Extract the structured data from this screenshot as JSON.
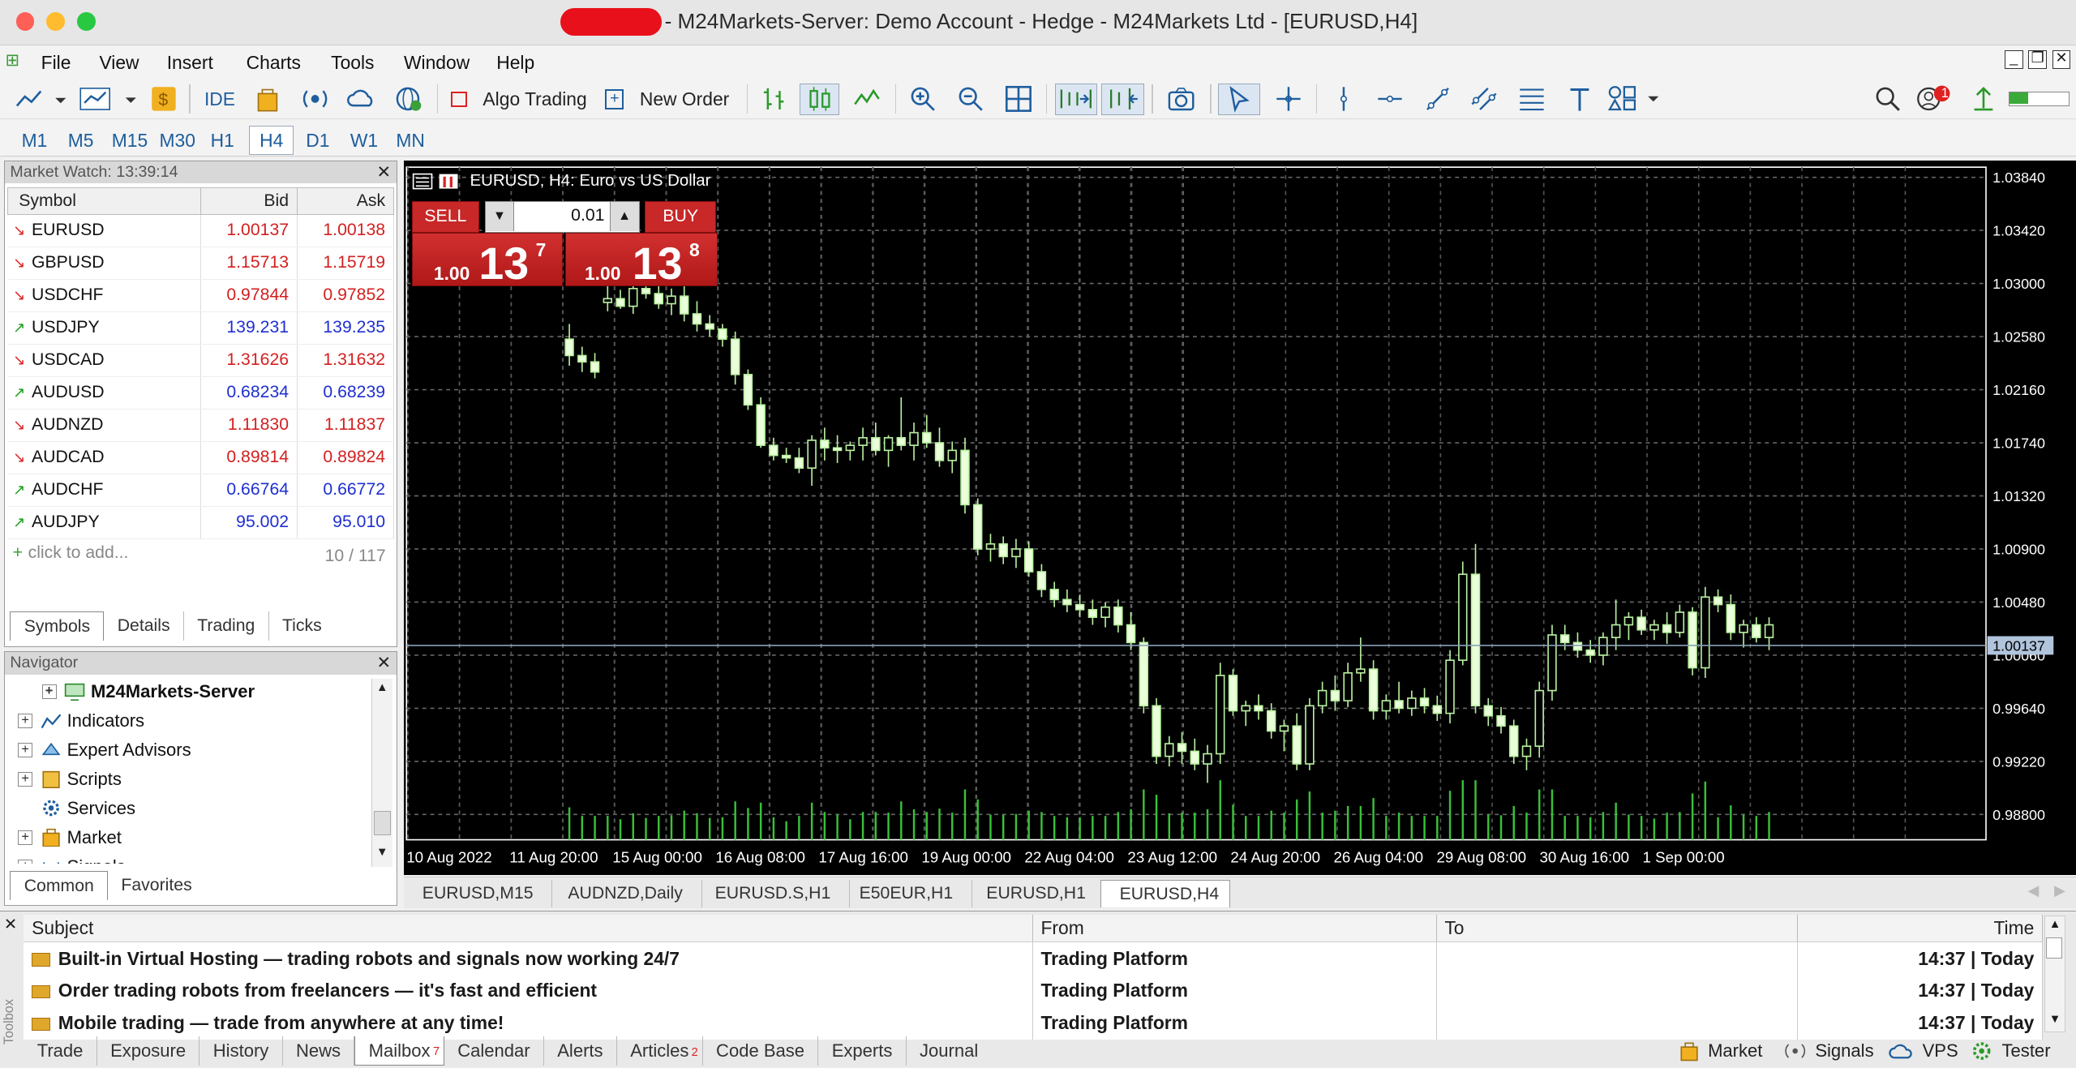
{
  "window": {
    "title": "- M24Markets-Server: Demo Account - Hedge - M24Markets Ltd - [EURUSD,H4]"
  },
  "menu": [
    "File",
    "View",
    "Insert",
    "Charts",
    "Tools",
    "Window",
    "Help"
  ],
  "toolbar": {
    "ide": "IDE",
    "algo_trading": "Algo Trading",
    "new_order": "New Order",
    "notification_count": "1"
  },
  "timeframes": [
    "M1",
    "M5",
    "M15",
    "M30",
    "H1",
    "H4",
    "D1",
    "W1",
    "MN"
  ],
  "active_timeframe": "H4",
  "market_watch": {
    "title": "Market Watch: 13:39:14",
    "columns": [
      "Symbol",
      "Bid",
      "Ask"
    ],
    "rows": [
      {
        "symbol": "EURUSD",
        "bid": "1.00137",
        "ask": "1.00138",
        "dir": "down",
        "color": "red"
      },
      {
        "symbol": "GBPUSD",
        "bid": "1.15713",
        "ask": "1.15719",
        "dir": "down",
        "color": "red"
      },
      {
        "symbol": "USDCHF",
        "bid": "0.97844",
        "ask": "0.97852",
        "dir": "down",
        "color": "red"
      },
      {
        "symbol": "USDJPY",
        "bid": "139.231",
        "ask": "139.235",
        "dir": "up",
        "color": "blue"
      },
      {
        "symbol": "USDCAD",
        "bid": "1.31626",
        "ask": "1.31632",
        "dir": "down",
        "color": "red"
      },
      {
        "symbol": "AUDUSD",
        "bid": "0.68234",
        "ask": "0.68239",
        "dir": "up",
        "color": "blue"
      },
      {
        "symbol": "AUDNZD",
        "bid": "1.11830",
        "ask": "1.11837",
        "dir": "down",
        "color": "red"
      },
      {
        "symbol": "AUDCAD",
        "bid": "0.89814",
        "ask": "0.89824",
        "dir": "down",
        "color": "red"
      },
      {
        "symbol": "AUDCHF",
        "bid": "0.66764",
        "ask": "0.66772",
        "dir": "up",
        "color": "blue"
      },
      {
        "symbol": "AUDJPY",
        "bid": "95.002",
        "ask": "95.010",
        "dir": "up",
        "color": "blue"
      }
    ],
    "add_label": "click to add...",
    "count": "10 / 117",
    "tabs": [
      "Symbols",
      "Details",
      "Trading",
      "Ticks"
    ]
  },
  "navigator": {
    "title": "Navigator",
    "items": [
      "M24Markets-Server",
      "Indicators",
      "Expert Advisors",
      "Scripts",
      "Services",
      "Market",
      "Signals"
    ],
    "tabs": [
      "Common",
      "Favorites"
    ]
  },
  "chart": {
    "header": "EURUSD, H4:  Euro vs US Dollar",
    "sell_label": "SELL",
    "buy_label": "BUY",
    "lot": "0.01",
    "sell_small": "1.00",
    "sell_big": "13",
    "sell_sup": "7",
    "buy_small": "1.00",
    "buy_big": "13",
    "buy_sup": "8",
    "current_price": "1.00137",
    "price_labels": [
      "1.03840",
      "1.03420",
      "1.03000",
      "1.02580",
      "1.02160",
      "1.01740",
      "1.01320",
      "1.00900",
      "1.00480",
      "1.00060",
      "0.99640",
      "0.99220",
      "0.98800"
    ],
    "time_labels": [
      "10 Aug 2022",
      "11 Aug 20:00",
      "15 Aug 00:00",
      "16 Aug 08:00",
      "17 Aug 16:00",
      "19 Aug 00:00",
      "22 Aug 04:00",
      "23 Aug 12:00",
      "24 Aug 20:00",
      "26 Aug 04:00",
      "29 Aug 08:00",
      "30 Aug 16:00",
      "1 Sep 00:00"
    ]
  },
  "chart_data": {
    "type": "candlestick",
    "symbol": "EURUSD",
    "timeframe": "H4",
    "ylim": [
      0.986,
      1.0392
    ],
    "candles": [
      [
        1.0256,
        1.0268,
        1.0235,
        1.0243
      ],
      [
        1.0243,
        1.025,
        1.023,
        1.0238
      ],
      [
        1.0238,
        1.0245,
        1.0225,
        1.023
      ],
      [
        1.0285,
        1.0298,
        1.0278,
        1.0288
      ],
      [
        1.0288,
        1.0295,
        1.028,
        1.0282
      ],
      [
        1.0282,
        1.03,
        1.0276,
        1.0296
      ],
      [
        1.0296,
        1.0305,
        1.0288,
        1.0292
      ],
      [
        1.0292,
        1.03,
        1.028,
        1.0284
      ],
      [
        1.0284,
        1.0296,
        1.0275,
        1.029
      ],
      [
        1.029,
        1.0298,
        1.027,
        1.0276
      ],
      [
        1.0276,
        1.0286,
        1.0262,
        1.0268
      ],
      [
        1.0268,
        1.0275,
        1.0258,
        1.0264
      ],
      [
        1.0264,
        1.0268,
        1.025,
        1.0256
      ],
      [
        1.0256,
        1.0262,
        1.022,
        1.0228
      ],
      [
        1.0228,
        1.0232,
        1.02,
        1.0204
      ],
      [
        1.0204,
        1.021,
        1.017,
        1.0172
      ],
      [
        1.0172,
        1.0178,
        1.016,
        1.0164
      ],
      [
        1.0164,
        1.017,
        1.0158,
        1.0162
      ],
      [
        1.0162,
        1.017,
        1.015,
        1.0154
      ],
      [
        1.0154,
        1.018,
        1.014,
        1.0176
      ],
      [
        1.0176,
        1.0186,
        1.016,
        1.017
      ],
      [
        1.017,
        1.018,
        1.0158,
        1.0168
      ],
      [
        1.0168,
        1.0175,
        1.016,
        1.0172
      ],
      [
        1.0172,
        1.0186,
        1.016,
        1.0178
      ],
      [
        1.0178,
        1.019,
        1.0164,
        1.0168
      ],
      [
        1.0168,
        1.018,
        1.0155,
        1.0178
      ],
      [
        1.0178,
        1.021,
        1.0168,
        1.0172
      ],
      [
        1.0172,
        1.019,
        1.016,
        1.0182
      ],
      [
        1.0182,
        1.0196,
        1.017,
        1.0174
      ],
      [
        1.0174,
        1.0186,
        1.0155,
        1.016
      ],
      [
        1.016,
        1.0175,
        1.015,
        1.0168
      ],
      [
        1.0168,
        1.0178,
        1.0118,
        1.0125
      ],
      [
        1.0125,
        1.013,
        1.0085,
        1.009
      ],
      [
        1.009,
        1.0102,
        1.008,
        1.0094
      ],
      [
        1.0094,
        1.01,
        1.0078,
        1.0084
      ],
      [
        1.0084,
        1.0098,
        1.0075,
        1.009
      ],
      [
        1.009,
        1.0096,
        1.0068,
        1.0072
      ],
      [
        1.0072,
        1.0078,
        1.0052,
        1.0058
      ],
      [
        1.0058,
        1.0064,
        1.0044,
        1.005
      ],
      [
        1.005,
        1.0058,
        1.004,
        1.0046
      ],
      [
        1.0046,
        1.0054,
        1.0036,
        1.0042
      ],
      [
        1.0042,
        1.005,
        1.003,
        1.0036
      ],
      [
        1.0036,
        1.0048,
        1.0028,
        1.0044
      ],
      [
        1.0044,
        1.005,
        1.0024,
        1.003
      ],
      [
        1.003,
        1.004,
        1.001,
        1.0016
      ],
      [
        1.0016,
        1.002,
        0.996,
        0.9966
      ],
      [
        0.9966,
        0.9972,
        0.992,
        0.9926
      ],
      [
        0.9926,
        0.9942,
        0.9918,
        0.9936
      ],
      [
        0.9936,
        0.9945,
        0.992,
        0.993
      ],
      [
        0.993,
        0.994,
        0.9915,
        0.992
      ],
      [
        0.992,
        0.9935,
        0.9905,
        0.9928
      ],
      [
        0.9928,
        1.0,
        0.992,
        0.999
      ],
      [
        0.999,
        0.9995,
        0.9958,
        0.9962
      ],
      [
        0.9962,
        0.997,
        0.995,
        0.9966
      ],
      [
        0.9966,
        0.9975,
        0.9955,
        0.9962
      ],
      [
        0.9962,
        0.9968,
        0.994,
        0.9946
      ],
      [
        0.9946,
        0.9955,
        0.993,
        0.995
      ],
      [
        0.995,
        0.996,
        0.9915,
        0.992
      ],
      [
        0.992,
        0.9972,
        0.9915,
        0.9966
      ],
      [
        0.9966,
        0.9985,
        0.996,
        0.9978
      ],
      [
        0.9978,
        0.999,
        0.9962,
        0.997
      ],
      [
        0.997,
        1.0,
        0.9965,
        0.9992
      ],
      [
        0.9992,
        1.002,
        0.9985,
        0.9995
      ],
      [
        0.9995,
        1.0002,
        0.9955,
        0.9962
      ],
      [
        0.9962,
        0.9975,
        0.9955,
        0.997
      ],
      [
        0.997,
        0.9985,
        0.996,
        0.9964
      ],
      [
        0.9964,
        0.9978,
        0.9958,
        0.9972
      ],
      [
        0.9972,
        0.998,
        0.996,
        0.9966
      ],
      [
        0.9966,
        0.9974,
        0.9954,
        0.996
      ],
      [
        0.996,
        1.001,
        0.9952,
        1.0002
      ],
      [
        1.0002,
        1.008,
        0.9998,
        1.007
      ],
      [
        1.007,
        1.0094,
        0.996,
        0.9966
      ],
      [
        0.9966,
        0.9972,
        0.995,
        0.9958
      ],
      [
        0.9958,
        0.9965,
        0.9944,
        0.995
      ],
      [
        0.995,
        0.9955,
        0.992,
        0.9926
      ],
      [
        0.9926,
        0.994,
        0.9915,
        0.9934
      ],
      [
        0.9934,
        0.9985,
        0.9925,
        0.9978
      ],
      [
        0.9978,
        1.003,
        0.997,
        1.0022
      ],
      [
        1.0022,
        1.003,
        1.001,
        1.0016
      ],
      [
        1.0016,
        1.0024,
        1.0004,
        1.001
      ],
      [
        1.001,
        1.0018,
        1.0,
        1.0006
      ],
      [
        1.0006,
        1.0024,
        0.9998,
        1.002
      ],
      [
        1.002,
        1.005,
        1.001,
        1.003
      ],
      [
        1.003,
        1.004,
        1.0018,
        1.0036
      ],
      [
        1.0036,
        1.0042,
        1.0022,
        1.0026
      ],
      [
        1.0026,
        1.0034,
        1.0018,
        1.003
      ],
      [
        1.003,
        1.004,
        1.0015,
        1.0024
      ],
      [
        1.0024,
        1.0046,
        1.002,
        1.004
      ],
      [
        1.004,
        1.0044,
        0.999,
        0.9996
      ],
      [
        0.9996,
        1.006,
        0.9988,
        1.0052
      ],
      [
        1.0052,
        1.0058,
        1.004,
        1.0046
      ],
      [
        1.0046,
        1.0054,
        1.0018,
        1.0024
      ],
      [
        1.0024,
        1.0034,
        1.0012,
        1.003
      ],
      [
        1.003,
        1.0036,
        1.0016,
        1.002
      ],
      [
        1.002,
        1.0036,
        1.001,
        1.003
      ]
    ]
  },
  "doc_tabs": [
    "EURUSD,M15",
    "AUDNZD,Daily",
    "EURUSD.S,H1",
    "E50EUR,H1",
    "EURUSD,H1",
    "EURUSD,H4"
  ],
  "toolbox": {
    "columns": [
      "Subject",
      "From",
      "To",
      "Time"
    ],
    "rows": [
      {
        "subject": "Built-in Virtual Hosting — trading robots and signals now working 24/7",
        "from": "Trading Platform",
        "to": "",
        "time": "14:37 | Today"
      },
      {
        "subject": "Order trading robots from freelancers — it's fast and efficient",
        "from": "Trading Platform",
        "to": "",
        "time": "14:37 | Today"
      },
      {
        "subject": "Mobile trading — trade from anywhere at any time!",
        "from": "Trading Platform",
        "to": "",
        "time": "14:37 | Today"
      }
    ],
    "tabs": [
      "Trade",
      "Exposure",
      "History",
      "News",
      "Mailbox",
      "Calendar",
      "Alerts",
      "Articles",
      "Code Base",
      "Experts",
      "Journal"
    ],
    "mailbox_badge": "7",
    "articles_badge": "2",
    "right_links": [
      "Market",
      "Signals",
      "VPS",
      "Tester"
    ],
    "side_label": "Toolbox"
  }
}
